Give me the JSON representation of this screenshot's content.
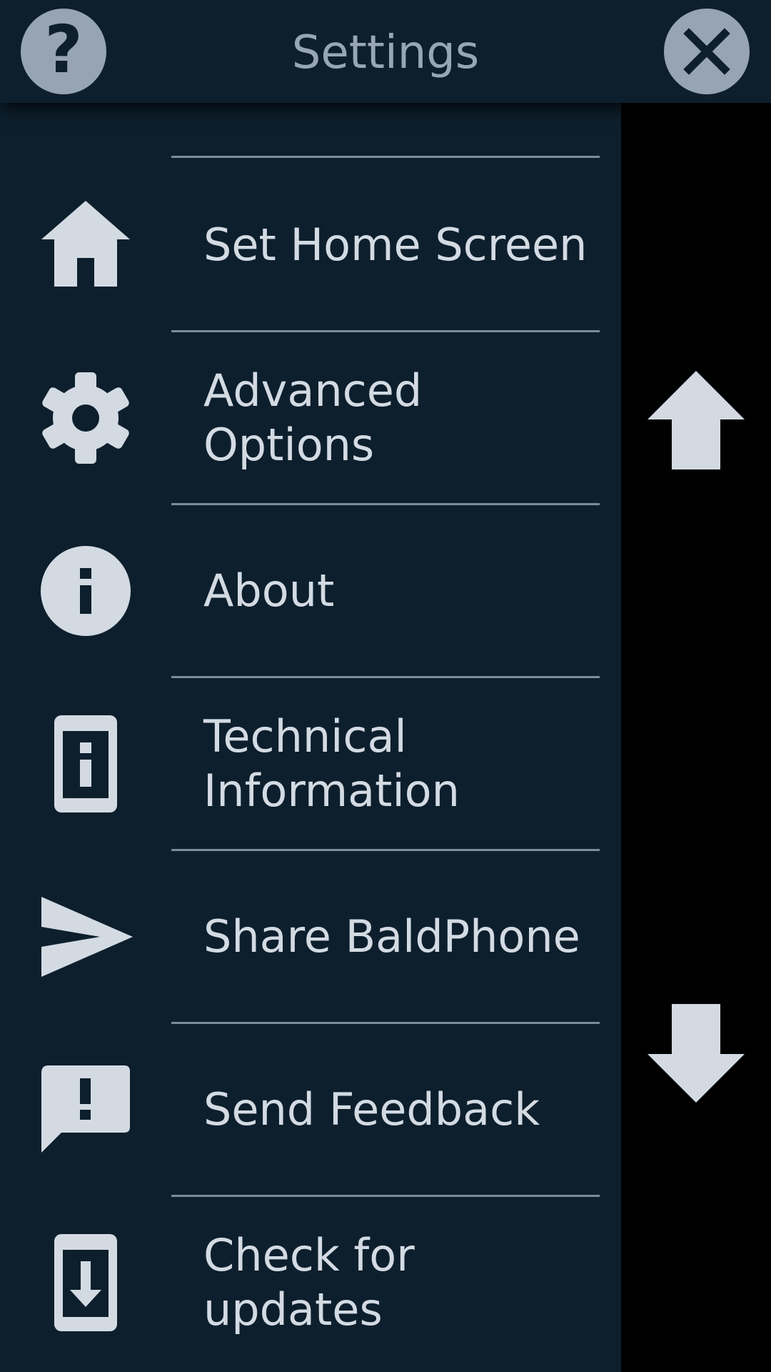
{
  "header": {
    "title": "Settings",
    "help_label": "?"
  },
  "menu": {
    "items": [
      {
        "label": "Set Home Screen",
        "icon": "home-icon"
      },
      {
        "label": "Advanced\nOptions",
        "icon": "gear-icon"
      },
      {
        "label": "About",
        "icon": "info-icon"
      },
      {
        "label": "Technical\nInformation",
        "icon": "device-info-icon"
      },
      {
        "label": "Share BaldPhone",
        "icon": "send-icon"
      },
      {
        "label": "Send Feedback",
        "icon": "feedback-icon"
      },
      {
        "label": "Check for\nupdates",
        "icon": "download-update-icon"
      }
    ]
  },
  "colors": {
    "background": "#0d1f2d",
    "foreground": "#d3dae2",
    "header_button": "#97a5b2",
    "divider": "#7c8c99"
  }
}
